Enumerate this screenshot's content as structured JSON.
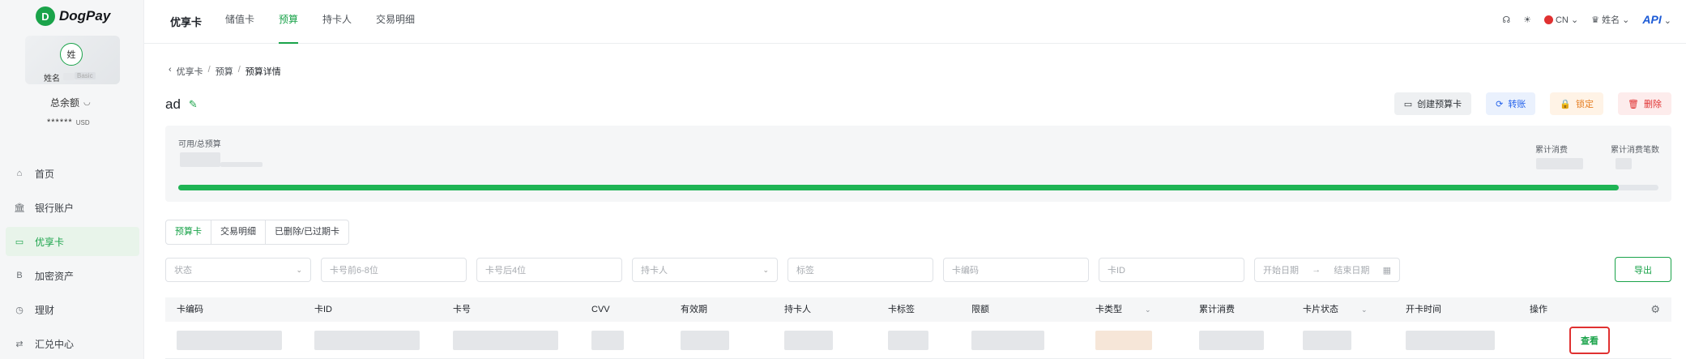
{
  "sidebar": {
    "logo_mark": "D",
    "logo_text": "DogPay",
    "avatar_initial": "姓",
    "user_name": "姓名",
    "plan_badge": "Basic",
    "balance_label": "总余额",
    "balance_value": "******",
    "balance_currency": "USD",
    "items": [
      {
        "label": "首页",
        "icon": "home-icon",
        "glyph": "⌂"
      },
      {
        "label": "银行账户",
        "icon": "bank-icon",
        "glyph": "🏛"
      },
      {
        "label": "优享卡",
        "icon": "card-icon",
        "glyph": "▭"
      },
      {
        "label": "加密资产",
        "icon": "crypto-icon",
        "glyph": "B"
      },
      {
        "label": "理财",
        "icon": "finance-icon",
        "glyph": "◷"
      },
      {
        "label": "汇兑中心",
        "icon": "exchange-icon",
        "glyph": "⇄"
      }
    ]
  },
  "topbar": {
    "title": "优享卡",
    "tabs": [
      "储值卡",
      "预算",
      "持卡人",
      "交易明细"
    ],
    "active_tab_index": 1,
    "language": "CN",
    "user_label": "姓名",
    "api_label": "API"
  },
  "breadcrumb": [
    "优享卡",
    "预算",
    "预算详情"
  ],
  "page": {
    "title": "ad",
    "actions": {
      "create": "创建预算卡",
      "transfer": "转账",
      "lock": "锁定",
      "delete": "删除"
    }
  },
  "summary": {
    "available_total_label": "可用/总预算",
    "total_spend_label": "累计消费",
    "spend_count_label": "累计消费笔数",
    "progress_percent": 97.3
  },
  "sub_tabs": [
    "预算卡",
    "交易明细",
    "已删除/已过期卡"
  ],
  "filters": {
    "status": "状态",
    "card_first": "卡号前6-8位",
    "card_last": "卡号后4位",
    "holder": "持卡人",
    "tag": "标签",
    "card_code": "卡编码",
    "card_id": "卡ID",
    "start_date": "开始日期",
    "end_date": "结束日期",
    "export": "导出"
  },
  "table": {
    "columns": [
      "卡编码",
      "卡ID",
      "卡号",
      "CVV",
      "有效期",
      "持卡人",
      "卡标签",
      "限额",
      "卡类型",
      "累计消费",
      "卡片状态",
      "开卡时间",
      "操作"
    ],
    "row_action": "查看"
  },
  "colors": {
    "brand": "#1aa34a",
    "progress": "#1eb454",
    "danger": "#e03131",
    "link": "#2563eb"
  }
}
